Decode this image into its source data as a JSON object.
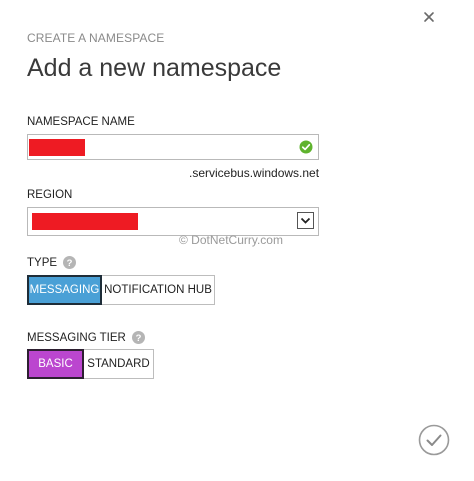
{
  "dialog": {
    "eyebrow": "CREATE A NAMESPACE",
    "title": "Add a new namespace"
  },
  "namespace_name": {
    "label": "NAMESPACE NAME",
    "suffix": ".servicebus.windows.net",
    "valid_icon": "check-circle-icon",
    "redaction_color": "#ee1b23"
  },
  "region": {
    "label": "REGION",
    "arrow_icon": "chevron-down-icon"
  },
  "watermark": "© DotNetCurry.com",
  "type": {
    "label": "TYPE",
    "options": [
      "MESSAGING",
      "NOTIFICATION HUB"
    ],
    "selected": "MESSAGING",
    "selected_color": "#4aa0d6"
  },
  "messaging_tier": {
    "label": "MESSAGING TIER",
    "options": [
      "BASIC",
      "STANDARD"
    ],
    "selected": "BASIC",
    "selected_color": "#bb46cf"
  },
  "icons": {
    "close": "close-icon",
    "help": "question-icon",
    "confirm": "checkmark-icon"
  }
}
